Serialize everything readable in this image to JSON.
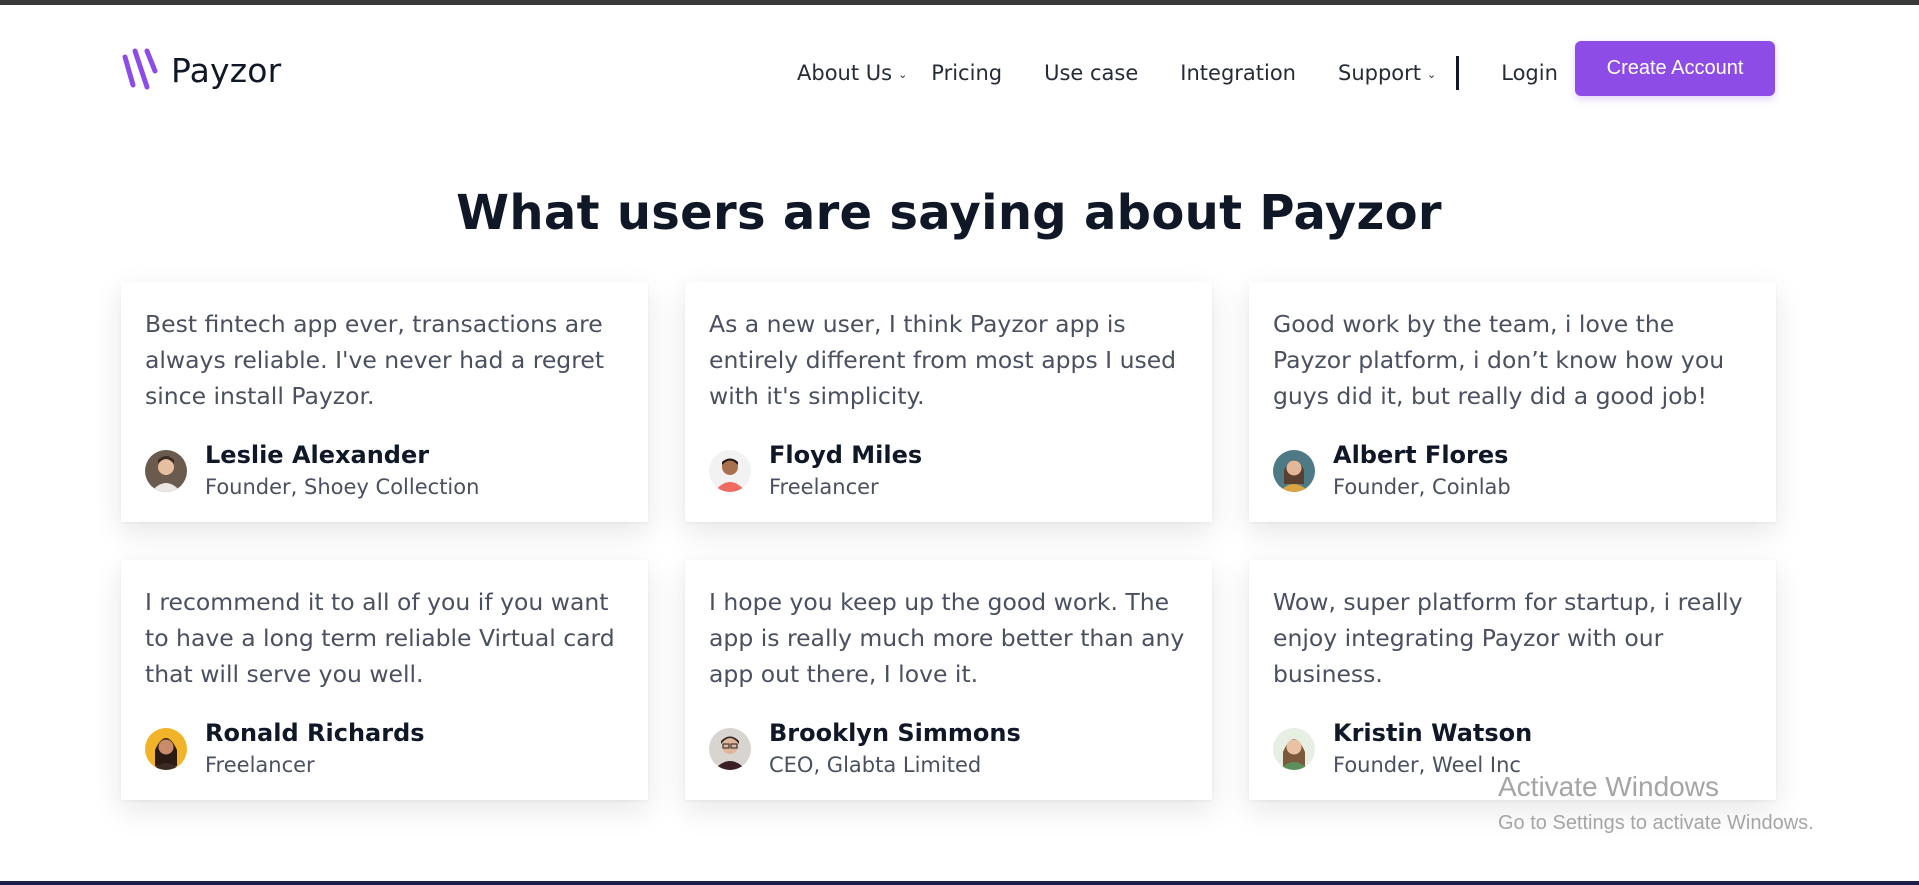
{
  "header": {
    "brand_name": "Payzor",
    "brand_color": "#8d4ce6",
    "nav": [
      {
        "label": "About Us",
        "has_dropdown": true,
        "icon": "chevron-down-icon"
      },
      {
        "label": "Pricing",
        "has_dropdown": false
      },
      {
        "label": "Use case",
        "has_dropdown": false
      },
      {
        "label": "Integration",
        "has_dropdown": false
      },
      {
        "label": "Support",
        "has_dropdown": true,
        "icon": "chevron-down-icon"
      }
    ],
    "login_label": "Login",
    "create_account_label": "Create Account"
  },
  "testimonials": {
    "title": "What users are saying about Payzor",
    "cards": [
      {
        "quote": "Best fintech app ever, transactions are always reliable. I've never had a regret since install Payzor.",
        "name": "Leslie Alexander",
        "role": "Founder, Shoey Collection",
        "avatar_bg": "#6b5b4e"
      },
      {
        "quote": "As a new user, I think Payzor app is entirely different from most apps I used with it's simplicity.",
        "name": "Floyd Miles",
        "role": "Freelancer",
        "avatar_bg": "#f2f2f2"
      },
      {
        "quote": "Good work by the team, i love the Payzor platform, i don’t know how you guys did it, but really did a good job!",
        "name": "Albert Flores",
        "role": "Founder, Coinlab",
        "avatar_bg": "#4e7a85"
      },
      {
        "quote": "I recommend it to all of you if you want to have a long term reliable Virtual card that will serve you well.",
        "name": "Ronald Richards",
        "role": "Freelancer",
        "avatar_bg": "#f0b32a"
      },
      {
        "quote": "I hope you keep up the good work. The app is really much more better than any app out there, I love it.",
        "name": "Brooklyn Simmons",
        "role": "CEO, Glabta Limited",
        "avatar_bg": "#d8d4cf"
      },
      {
        "quote": "Wow, super platform for startup, i really enjoy integrating Payzor with our business.",
        "name": "Kristin Watson",
        "role": "Founder, Weel Inc",
        "avatar_bg": "#e7efe4"
      }
    ]
  },
  "watermark": {
    "title": "Activate Windows",
    "subtitle": "Go to Settings to activate Windows."
  }
}
